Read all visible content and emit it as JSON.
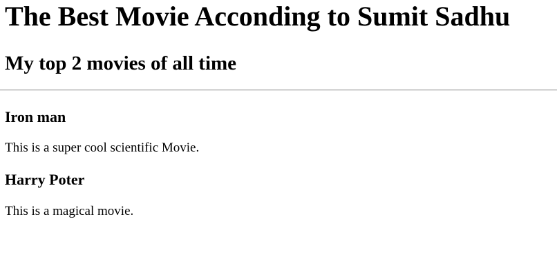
{
  "page": {
    "title": "The Best Movie Acconding to Sumit Sadhu",
    "subtitle": "My top 2 movies of all time"
  },
  "movies": [
    {
      "title": "Iron man",
      "description": "This is a super cool scientific Movie."
    },
    {
      "title": "Harry Poter",
      "description": "This is a magical movie."
    }
  ]
}
